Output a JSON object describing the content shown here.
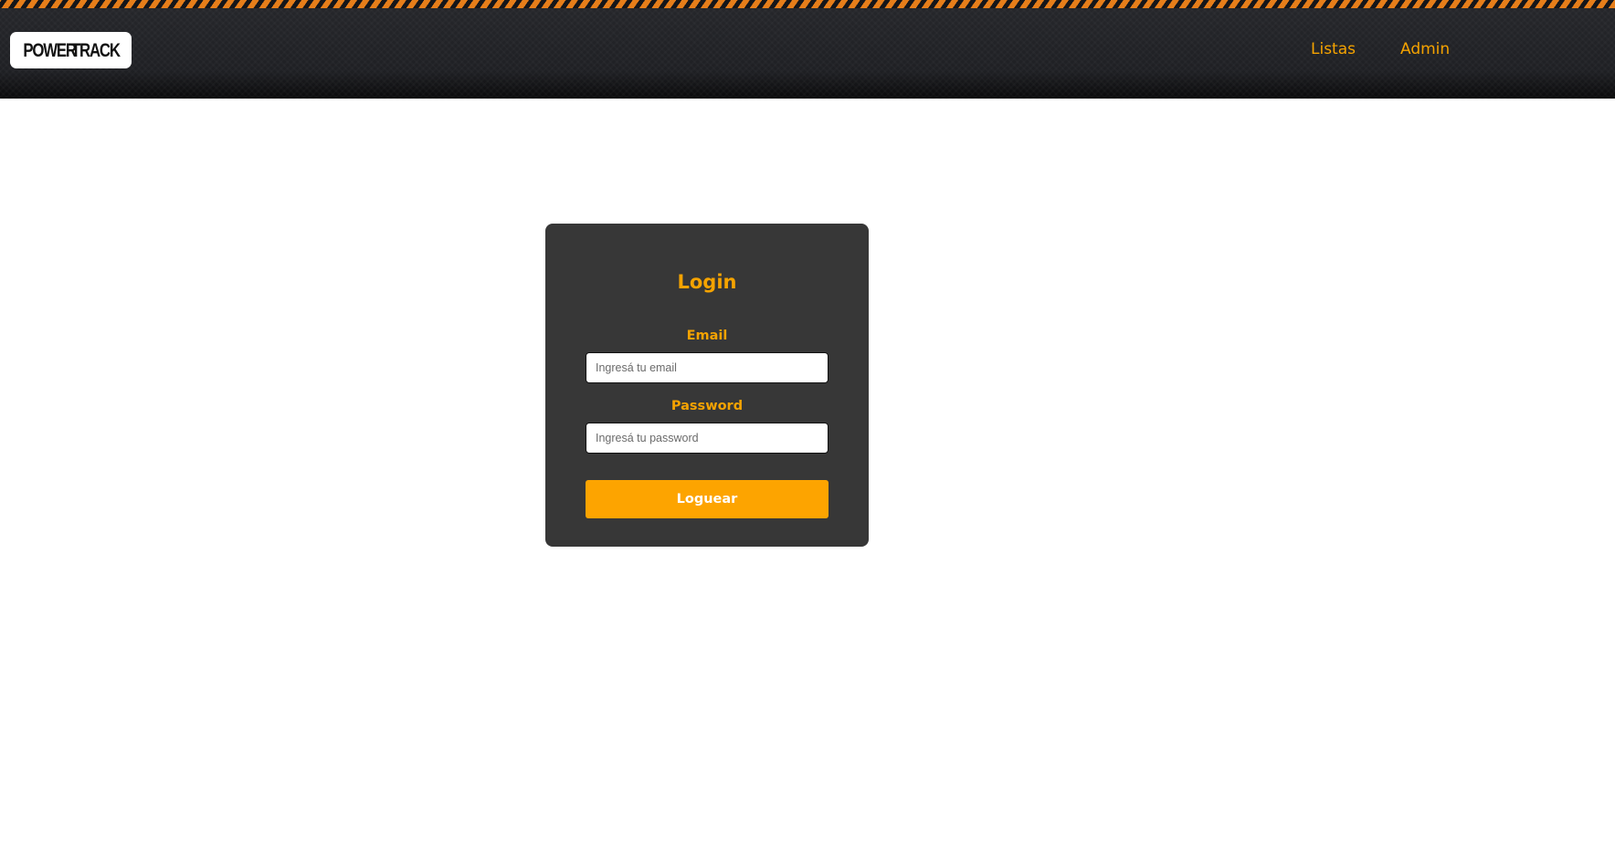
{
  "header": {
    "logo": {
      "left_word": "POWER",
      "right_word": "TRACK",
      "icon": "lightning-bolt-icon",
      "bolt_color": "#f5b800"
    },
    "nav": [
      {
        "label": "Listas"
      },
      {
        "label": "Admin"
      }
    ],
    "stripe_colors": [
      "#e67e1a",
      "#15161a"
    ]
  },
  "login": {
    "title": "Login",
    "email_label": "Email",
    "email_placeholder": "Ingresá tu email",
    "email_value": "",
    "password_label": "Password",
    "password_placeholder": "Ingresá tu password",
    "password_value": "",
    "submit_label": "Loguear"
  },
  "colors": {
    "accent": "#f5a300",
    "button": "#fda400",
    "card": "#373737",
    "header": "#1f2024"
  }
}
